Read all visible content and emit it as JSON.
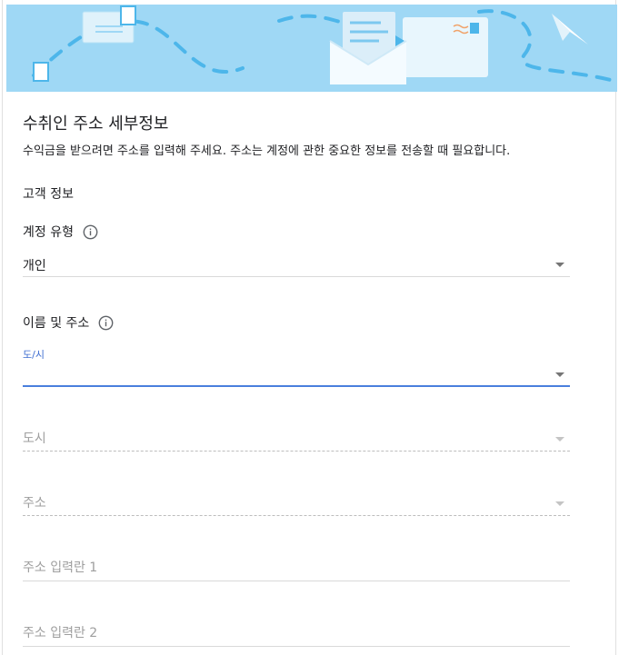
{
  "page": {
    "title": "수취인 주소 세부정보",
    "description": "수익금을 받으려면 주소를 입력해 주세요. 주소는 계정에 관한 중요한 정보를 전송할 때 필요합니다.",
    "section_customer": "고객 정보"
  },
  "account_type": {
    "label": "계정 유형",
    "value": "개인"
  },
  "name_address": {
    "label": "이름 및 주소"
  },
  "fields": {
    "province": {
      "floating_label": "도/시",
      "value": ""
    },
    "city": {
      "placeholder": "도시"
    },
    "address": {
      "placeholder": "주소"
    },
    "address_line1": {
      "placeholder": "주소 입력란 1"
    },
    "address_line2": {
      "placeholder": "주소 입력란 2"
    }
  },
  "icons": {
    "info": "info-icon",
    "dropdown": "caret-down-icon",
    "banner": "envelope-illustration"
  },
  "colors": {
    "banner_bg": "#9fd8f5",
    "focus_accent": "#4a7fdd",
    "floating_label": "#3f6ed1"
  }
}
